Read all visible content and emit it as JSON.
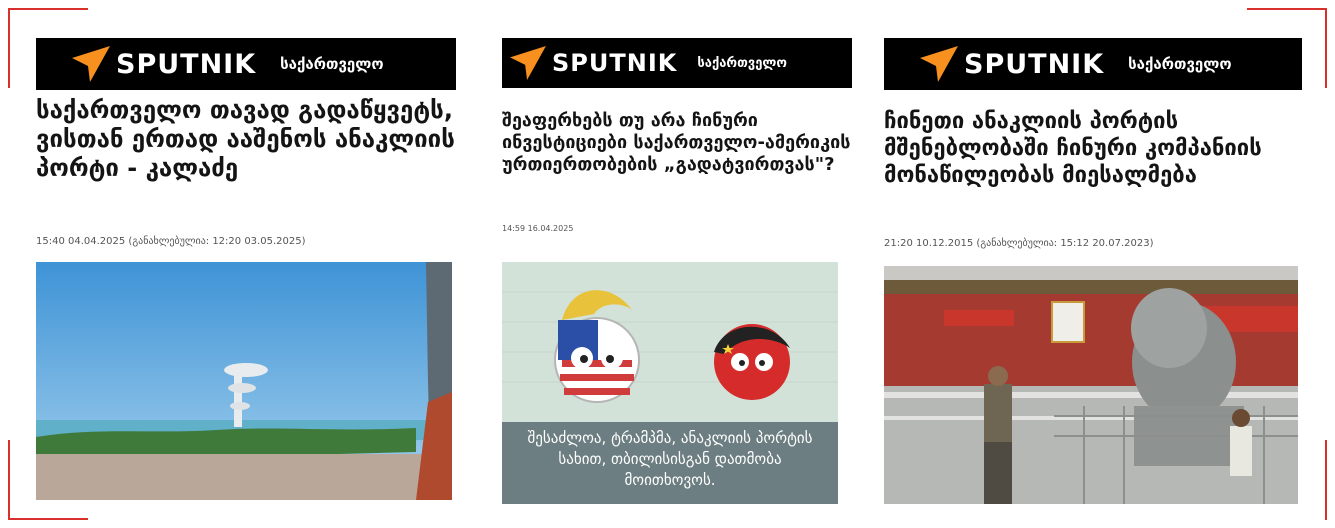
{
  "cards": [
    {
      "brand": "SPUTNIK",
      "region": "საქართველო",
      "headline": "საქართველო თავად გადაწყვეტს, ვისთან ერთად ააშენოს ანაკლიის პორტი - კალაძე",
      "meta": "15:40 04.04.2025 (განახლებულია: 12:20 03.05.2025)",
      "image_icon": "port-tower-photo"
    },
    {
      "brand": "SPUTNIK",
      "region": "საქართველო",
      "headline": "შეაფერხებს თუ არა ჩინური ინვესტიციები საქართველო-ამერიკის ურთიერთობების „გადატვირთვას\"?",
      "meta": "14:59 16.04.2025",
      "image_caption": "შესაძლოა, ტრამპმა, ანაკლიის პორტის სახით, თბილისისგან დათმობა მოითხოვოს.",
      "image_icon": "us-china-cartoon"
    },
    {
      "brand": "SPUTNIK",
      "region": "საქართველო",
      "headline": "ჩინეთი ანაკლიის პორტის მშენებლობაში ჩინური კომპანიის მონაწილეობას მიესალმება",
      "meta": "21:20 10.12.2015 (განახლებულია: 15:12 20.07.2023)",
      "image_icon": "tiananmen-lion-photo"
    }
  ],
  "colors": {
    "accent_red": "#d8302a",
    "logo_orange": "#f7901e",
    "banner_black": "#000000"
  }
}
